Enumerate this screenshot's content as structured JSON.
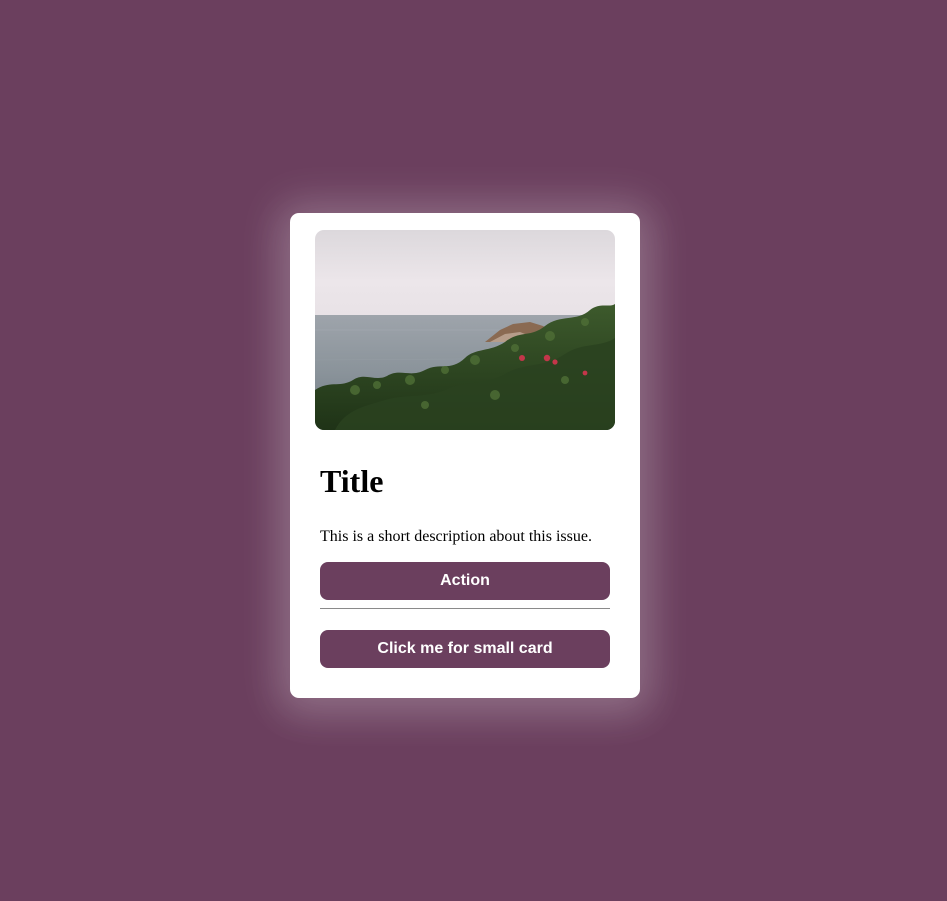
{
  "page": {
    "background_color": "#6b3f5e"
  },
  "card": {
    "image": {
      "alt": "",
      "subject": "coastal-landscape-photo"
    },
    "title": "Title",
    "description": "This is a short description about this issue.",
    "action_button_label": "Action",
    "small_card_button_label": "Click me for small card",
    "button_color": "#6b3f5e",
    "card_color": "#ffffff"
  }
}
